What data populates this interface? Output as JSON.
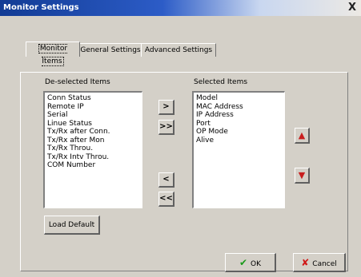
{
  "window": {
    "title": "Monitor Settings",
    "close_label": "X"
  },
  "tabs": [
    {
      "label": "Monitor Items",
      "active": true
    },
    {
      "label": "General Settings",
      "active": false
    },
    {
      "label": "Advanced Settings",
      "active": false
    }
  ],
  "deselected": {
    "header": "De-selected Items",
    "items": [
      "Conn Status",
      "Remote IP",
      "Serial",
      "Linue Status",
      "Tx/Rx after Conn.",
      "Tx/Rx after Mon",
      "Tx/Rx Throu.",
      "Tx/Rx Intv Throu.",
      "COM Number"
    ]
  },
  "selected": {
    "header": "Selected Items",
    "items": [
      "Model",
      "MAC Address",
      "IP Address",
      "Port",
      "OP Mode",
      "Alive"
    ]
  },
  "transfer_buttons": {
    "add_one": ">",
    "add_all": ">>",
    "remove_one": "<",
    "remove_all": "<<"
  },
  "order_buttons": {
    "up": "▲",
    "down": "▼"
  },
  "load_default_label": "Load Default",
  "ok_label": "OK",
  "cancel_label": "Cancel",
  "icons": {
    "ok": "check-icon",
    "cancel": "cross-icon"
  },
  "colors": {
    "title_bar": "#123b94",
    "arrow_red": "#c81e1e",
    "ok_green": "#1a9a1a"
  }
}
